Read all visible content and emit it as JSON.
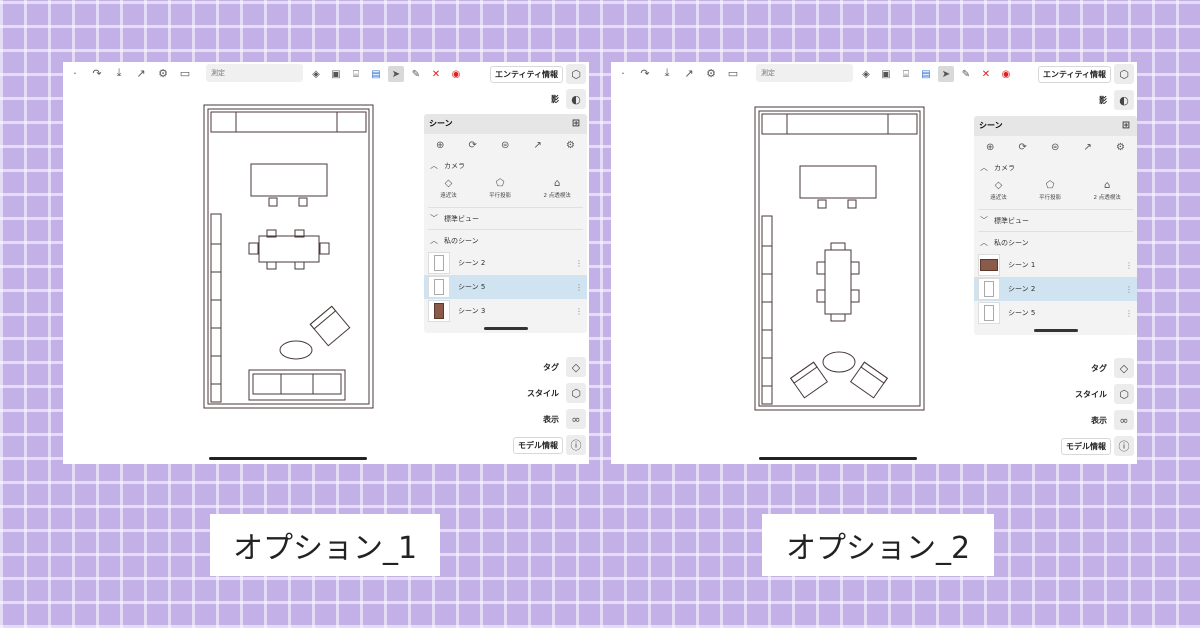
{
  "colors": {
    "background": "#c3b0e6",
    "selected_row": "#cfe3f1",
    "plan_line": "#4a3a3a"
  },
  "panels": [
    {
      "toolbar": {
        "undo_icon": "undo-icon",
        "redo_icon": "redo-icon",
        "measure_placeholder": "測定"
      },
      "entity_info": "エンティティ情報",
      "shadow": "影",
      "scene_panel": {
        "title": "シーン",
        "camera_section": "カメラ",
        "cameras": [
          "遠近法",
          "平行投影",
          "2 点透視法"
        ],
        "standard_views": "標準ビュー",
        "my_scenes": "私のシーン",
        "scenes": [
          {
            "name": "シーン 2",
            "selected": false,
            "thumb": "plan"
          },
          {
            "name": "シーン 5",
            "selected": true,
            "thumb": "plan"
          },
          {
            "name": "シーン 3",
            "selected": false,
            "thumb": "dark"
          }
        ]
      },
      "buttons": {
        "tag": "タグ",
        "style": "スタイル",
        "display": "表示",
        "model_info": "モデル情報"
      }
    },
    {
      "toolbar": {
        "undo_icon": "undo-icon",
        "redo_icon": "redo-icon",
        "measure_placeholder": "測定"
      },
      "entity_info": "エンティティ情報",
      "shadow": "影",
      "scene_panel": {
        "title": "シーン",
        "camera_section": "カメラ",
        "cameras": [
          "遠近法",
          "平行投影",
          "2 点透視法"
        ],
        "standard_views": "標準ビュー",
        "my_scenes": "私のシーン",
        "scenes": [
          {
            "name": "シーン 1",
            "selected": false,
            "thumb": "iso"
          },
          {
            "name": "シーン 2",
            "selected": true,
            "thumb": "plan"
          },
          {
            "name": "シーン 5",
            "selected": false,
            "thumb": "plan"
          }
        ]
      },
      "buttons": {
        "tag": "タグ",
        "style": "スタイル",
        "display": "表示",
        "model_info": "モデル情報"
      }
    }
  ],
  "captions": [
    "オプション_1",
    "オプション_2"
  ]
}
